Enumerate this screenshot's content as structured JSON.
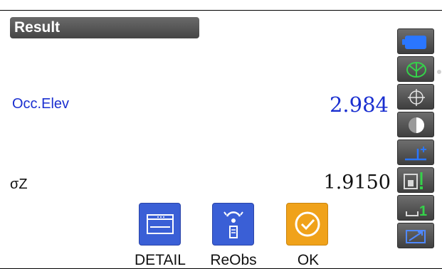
{
  "header": {
    "title": "Result"
  },
  "fields": [
    {
      "label": "Occ.Elev",
      "value": "2.984"
    },
    {
      "label": "σZ",
      "value": "1.9150"
    }
  ],
  "softkeys": [
    {
      "label": "DETAIL",
      "icon": "detail-icon",
      "color": "#3a5fd6"
    },
    {
      "label": "ReObs",
      "icon": "reobserve-icon",
      "color": "#3a5fd6"
    },
    {
      "label": "OK",
      "icon": "ok-check-icon",
      "color": "#f0a21a"
    }
  ],
  "status_icons": [
    {
      "icon": "battery-icon",
      "accent": "#2a76ff"
    },
    {
      "icon": "target-prism-icon",
      "accent": "#35d24a"
    },
    {
      "icon": "crosshair-icon",
      "accent": "#ffffff"
    },
    {
      "icon": "laser-half-circle-icon",
      "accent": "#ffffff"
    },
    {
      "icon": "prism-constant-plus-icon",
      "accent": "#2a76ff"
    },
    {
      "icon": "tilt-level-icon",
      "accent": "#35d24a"
    },
    {
      "icon": "input-mode-1-icon",
      "accent": "#35d24a"
    },
    {
      "icon": "bluetooth-link-icon",
      "accent": "#4f88ff"
    }
  ]
}
